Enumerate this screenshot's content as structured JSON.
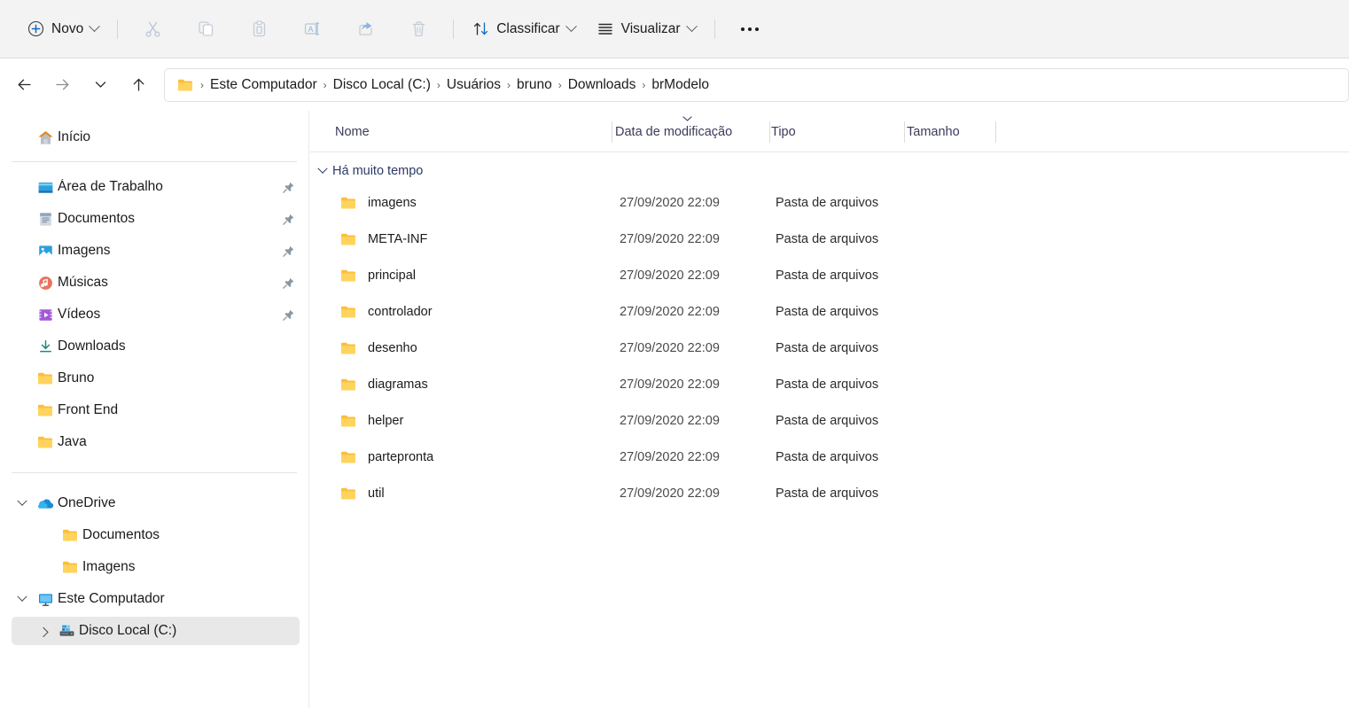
{
  "toolbar": {
    "new_label": "Novo",
    "new_icon": "plus-circle-icon",
    "cut_icon": "cut-icon",
    "copy_icon": "copy-icon",
    "paste_icon": "paste-icon",
    "rename_icon": "rename-icon",
    "share_icon": "share-icon",
    "delete_icon": "delete-icon",
    "sort_label": "Classificar",
    "sort_icon": "sort-icon",
    "view_label": "Visualizar",
    "view_icon": "view-list-icon",
    "more_icon": "ellipsis-icon"
  },
  "nav": {
    "back_icon": "arrow-left-icon",
    "forward_icon": "arrow-right-icon",
    "recent_icon": "chevron-down-icon",
    "up_icon": "arrow-up-icon",
    "folder_icon": "folder-icon",
    "breadcrumbs": [
      "Este Computador",
      "Disco Local (C:)",
      "Usuários",
      "bruno",
      "Downloads",
      "brModelo"
    ],
    "separator": "›"
  },
  "sidebar": {
    "home": {
      "label": "Início",
      "icon": "home-icon"
    },
    "quick_access": [
      {
        "label": "Área de Trabalho",
        "icon": "desktop-icon",
        "pinned": true
      },
      {
        "label": "Documentos",
        "icon": "documents-icon",
        "pinned": true
      },
      {
        "label": "Imagens",
        "icon": "pictures-icon",
        "pinned": true
      },
      {
        "label": "Músicas",
        "icon": "music-icon",
        "pinned": true
      },
      {
        "label": "Vídeos",
        "icon": "videos-icon",
        "pinned": true
      },
      {
        "label": "Downloads",
        "icon": "downloads-icon",
        "pinned": false
      },
      {
        "label": "Bruno",
        "icon": "folder-icon",
        "pinned": false
      },
      {
        "label": "Front End",
        "icon": "folder-icon",
        "pinned": false
      },
      {
        "label": "Java",
        "icon": "folder-icon",
        "pinned": false
      }
    ],
    "onedrive": {
      "label": "OneDrive",
      "icon": "cloud-icon",
      "expanded": true
    },
    "onedrive_children": [
      {
        "label": "Documentos",
        "icon": "folder-icon"
      },
      {
        "label": "Imagens",
        "icon": "folder-icon"
      }
    ],
    "this_pc": {
      "label": "Este Computador",
      "icon": "monitor-icon",
      "expanded": true
    },
    "this_pc_children": [
      {
        "label": "Disco Local (C:)",
        "icon": "drive-icon",
        "selected": true,
        "expanded": false
      }
    ]
  },
  "list": {
    "columns": [
      {
        "label": "Nome",
        "sorted": false
      },
      {
        "label": "Data de modificação",
        "sorted": true
      },
      {
        "label": "Tipo",
        "sorted": false
      },
      {
        "label": "Tamanho",
        "sorted": false
      }
    ],
    "group_label": "Há muito tempo",
    "rows": [
      {
        "name": "imagens",
        "date": "27/09/2020 22:09",
        "type": "Pasta de arquivos",
        "size": "",
        "icon": "folder-icon"
      },
      {
        "name": "META-INF",
        "date": "27/09/2020 22:09",
        "type": "Pasta de arquivos",
        "size": "",
        "icon": "folder-icon"
      },
      {
        "name": "principal",
        "date": "27/09/2020 22:09",
        "type": "Pasta de arquivos",
        "size": "",
        "icon": "folder-icon"
      },
      {
        "name": "controlador",
        "date": "27/09/2020 22:09",
        "type": "Pasta de arquivos",
        "size": "",
        "icon": "folder-icon"
      },
      {
        "name": "desenho",
        "date": "27/09/2020 22:09",
        "type": "Pasta de arquivos",
        "size": "",
        "icon": "folder-icon"
      },
      {
        "name": "diagramas",
        "date": "27/09/2020 22:09",
        "type": "Pasta de arquivos",
        "size": "",
        "icon": "folder-icon"
      },
      {
        "name": "helper",
        "date": "27/09/2020 22:09",
        "type": "Pasta de arquivos",
        "size": "",
        "icon": "folder-icon"
      },
      {
        "name": "partepronta",
        "date": "27/09/2020 22:09",
        "type": "Pasta de arquivos",
        "size": "",
        "icon": "folder-icon"
      },
      {
        "name": "util",
        "date": "27/09/2020 22:09",
        "type": "Pasta de arquivos",
        "size": "",
        "icon": "folder-icon"
      }
    ]
  },
  "colors": {
    "toolbar_bg": "#f3f3f3",
    "accent_blue": "#0f6cbd",
    "folder_yellow": "#ffd166",
    "selection_grey": "#e8e8e8",
    "group_text": "#2b3a67"
  }
}
